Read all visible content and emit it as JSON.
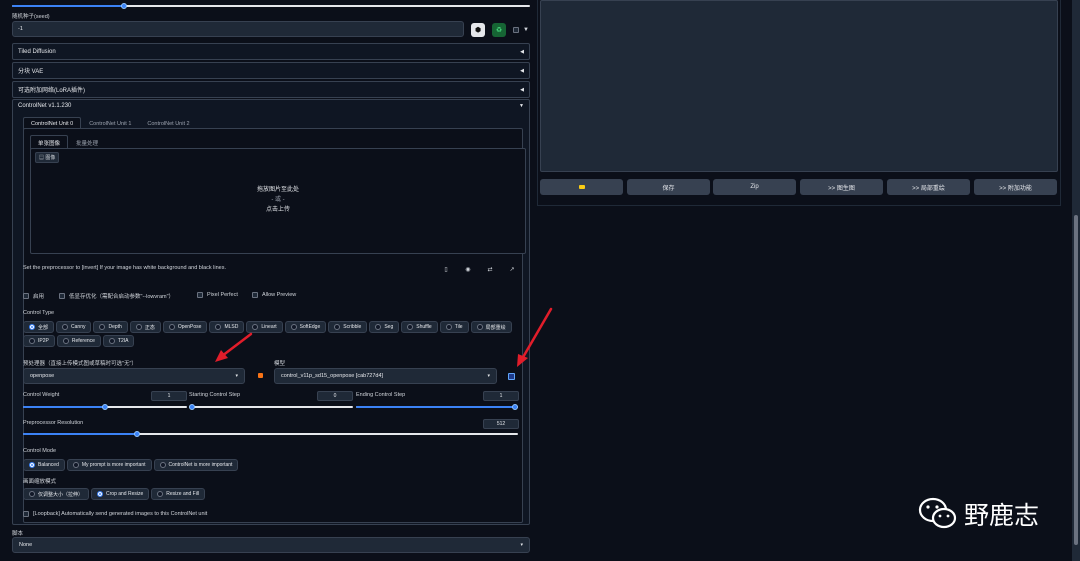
{
  "seed": {
    "label": "随机种子(seed)",
    "value": "-1",
    "dice_icon": "dice-icon",
    "recycle_icon": "recycle-icon"
  },
  "accordions": [
    {
      "label": "Tiled Diffusion"
    },
    {
      "label": "分块 VAE"
    },
    {
      "label": "可选附加网络(LoRA插件)"
    },
    {
      "label": "ControlNet v1.1.230"
    }
  ],
  "controlnet": {
    "unit_tabs": [
      "ControlNet Unit 0",
      "ControlNet Unit 1",
      "ControlNet Unit 2"
    ],
    "image_tabs": [
      "单张图像",
      "批量处理"
    ],
    "image_tag": "图像",
    "drop_lines": [
      "拖放图片至此处",
      "- 或 -",
      "点击上传"
    ],
    "hint": "Set the preprocessor to [invert] If your image has white background and black lines.",
    "checkboxes": [
      {
        "label": "启用",
        "checked": false
      },
      {
        "label": "低显存优化（需配合启动参数\"--lowvram\"）",
        "checked": false
      },
      {
        "label": "Pixel Perfect",
        "checked": false
      },
      {
        "label": "Allow Preview",
        "checked": false
      }
    ],
    "control_type_label": "Control Type",
    "control_types": [
      "全部",
      "Canny",
      "Depth",
      "正态",
      "OpenPose",
      "MLSD",
      "Lineart",
      "SoftEdge",
      "Scribble",
      "Seg",
      "Shuffle",
      "Tile",
      "局部重绘",
      "IP2P",
      "Reference",
      "T2IA"
    ],
    "control_type_selected": "全部",
    "preprocessor_label": "预处理器（直接上传模式图或草稿时可选\"无\"）",
    "preprocessor_value": "openpose",
    "model_label": "模型",
    "model_value": "control_v11p_sd15_openpose [cab727d4]",
    "weight_label": "Control Weight",
    "weight_value": "1",
    "weight_fraction": 0.5,
    "start_label": "Starting Control Step",
    "start_value": "0",
    "start_fraction": 0,
    "end_label": "Ending Control Step",
    "end_value": "1",
    "end_fraction": 1,
    "resolution_label": "Preprocessor Resolution",
    "resolution_value": "512",
    "resolution_fraction": 0.23,
    "mode_label": "Control Mode",
    "modes": [
      "Balanced",
      "My prompt is more important",
      "ControlNet is more important"
    ],
    "mode_selected": "Balanced",
    "resize_label": "画面缩放模式",
    "resize_modes": [
      "仅调整大小（拉伸）",
      "Crop and Resize",
      "Resize and Fill"
    ],
    "resize_selected": "Crop and Resize",
    "loopback_label": "[Loopback] Automatically send generated images to this ControlNet unit"
  },
  "script": {
    "label": "脚本",
    "value": "None"
  },
  "output_buttons": [
    {
      "label": "",
      "icon": "folder-icon"
    },
    {
      "label": "保存"
    },
    {
      "label": "Zip"
    },
    {
      "label": ">> 图生图"
    },
    {
      "label": ">> 局部重绘"
    },
    {
      "label": ">> 附加功能"
    }
  ],
  "watermark": {
    "text": "野鹿志"
  },
  "colors": {
    "accent": "#3b82f6",
    "arrow": "#e11d2a",
    "background": "#0b0f19"
  }
}
